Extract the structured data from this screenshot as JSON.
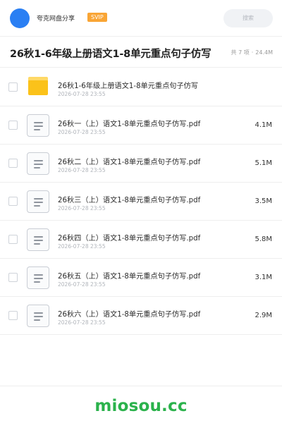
{
  "header": {
    "brand": "夸克网盘分享",
    "badge": "SVIP",
    "search_placeholder": "搜索"
  },
  "title_bar": {
    "title": "26秋1-6年级上册语文1-8单元重点句子仿写",
    "count_text": "共 7 项",
    "separator": "·",
    "total_size": "24.4M"
  },
  "files": [
    {
      "type": "folder",
      "name": "26秋1-6年级上册语文1-8单元重点句子仿写",
      "date": "2026-07-28 23:55",
      "size": ""
    },
    {
      "type": "pdf",
      "name": "26秋一（上）语文1-8单元重点句子仿写.pdf",
      "date": "2026-07-28 23:55",
      "size": "4.1M"
    },
    {
      "type": "pdf",
      "name": "26秋二（上）语文1-8单元重点句子仿写.pdf",
      "date": "2026-07-28 23:55",
      "size": "5.1M"
    },
    {
      "type": "pdf",
      "name": "26秋三（上）语文1-8单元重点句子仿写.pdf",
      "date": "2026-07-28 23:55",
      "size": "3.5M"
    },
    {
      "type": "pdf",
      "name": "26秋四（上）语文1-8单元重点句子仿写.pdf",
      "date": "2026-07-28 23:55",
      "size": "5.8M"
    },
    {
      "type": "pdf",
      "name": "26秋五（上）语文1-8单元重点句子仿写.pdf",
      "date": "2026-07-28 23:55",
      "size": "3.1M"
    },
    {
      "type": "pdf",
      "name": "26秋六（上）语文1-8单元重点句子仿写.pdf",
      "date": "2026-07-28 23:55",
      "size": "2.9M"
    }
  ],
  "footer": {
    "watermark": "miosou.cc"
  },
  "colors": {
    "avatar": "#2a7ff3",
    "badge": "#f9a535",
    "folder": "#fbc21a",
    "watermark": "#2bb24c"
  },
  "icons": {
    "folder": "folder-icon",
    "pdf": "document-icon"
  }
}
